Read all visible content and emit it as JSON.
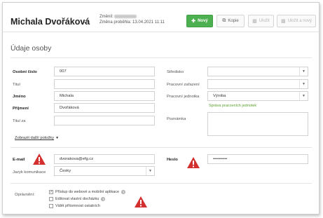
{
  "header": {
    "name": "Michala Dvořáková",
    "changed_label": "Změnil:",
    "changed_date": "Změna proběhla: 13.04.2021 11:11",
    "buttons": {
      "new": "Nový",
      "copy": "Kopie",
      "save": "Uložit",
      "save_new": "Uložit a nový"
    }
  },
  "section_title": "Údaje osoby",
  "left_fields": {
    "personal_number": {
      "label": "Osobní číslo",
      "value": "007"
    },
    "title": {
      "label": "Titul",
      "value": ""
    },
    "first_name": {
      "label": "Jméno",
      "value": "Michala"
    },
    "surname": {
      "label": "Příjmení",
      "value": "Dvořáková"
    },
    "title_after": {
      "label": "Titul za",
      "value": ""
    }
  },
  "right_fields": {
    "center": {
      "label": "Středisko",
      "value": ""
    },
    "position": {
      "label": "Pracovní zařazení",
      "value": ""
    },
    "unit": {
      "label": "Pracovní jednotka",
      "value": "Výroba"
    },
    "unit_link": "Správa pracovních jednotek",
    "note": {
      "label": "Poznámka",
      "value": ""
    }
  },
  "more_items": "Zobrazit další položky",
  "email": {
    "label": "E-mail",
    "value": "dvorakova@efg.cz"
  },
  "language": {
    "label": "Jazyk komunikace",
    "value": "Česky"
  },
  "password": {
    "label": "Heslo",
    "value": "••••••••••"
  },
  "permissions": {
    "label": "Oprávnění:",
    "items": [
      {
        "label": "Přístup do webové a mobilní aplikace",
        "checked": true
      },
      {
        "label": "Editovat vlastní docházku",
        "checked": false
      },
      {
        "label": "Vidět přítomnost ostatních",
        "checked": false
      }
    ]
  },
  "colors": {
    "accent": "#4caf50",
    "warning": "#d32f2f",
    "link": "#5aa02c"
  },
  "icons": {
    "new": "plus-icon",
    "copy": "copy-icon",
    "save": "floppy-icon",
    "save_new": "floppy-plus-icon",
    "warning": "warning-triangle-icon",
    "help": "help-icon"
  }
}
